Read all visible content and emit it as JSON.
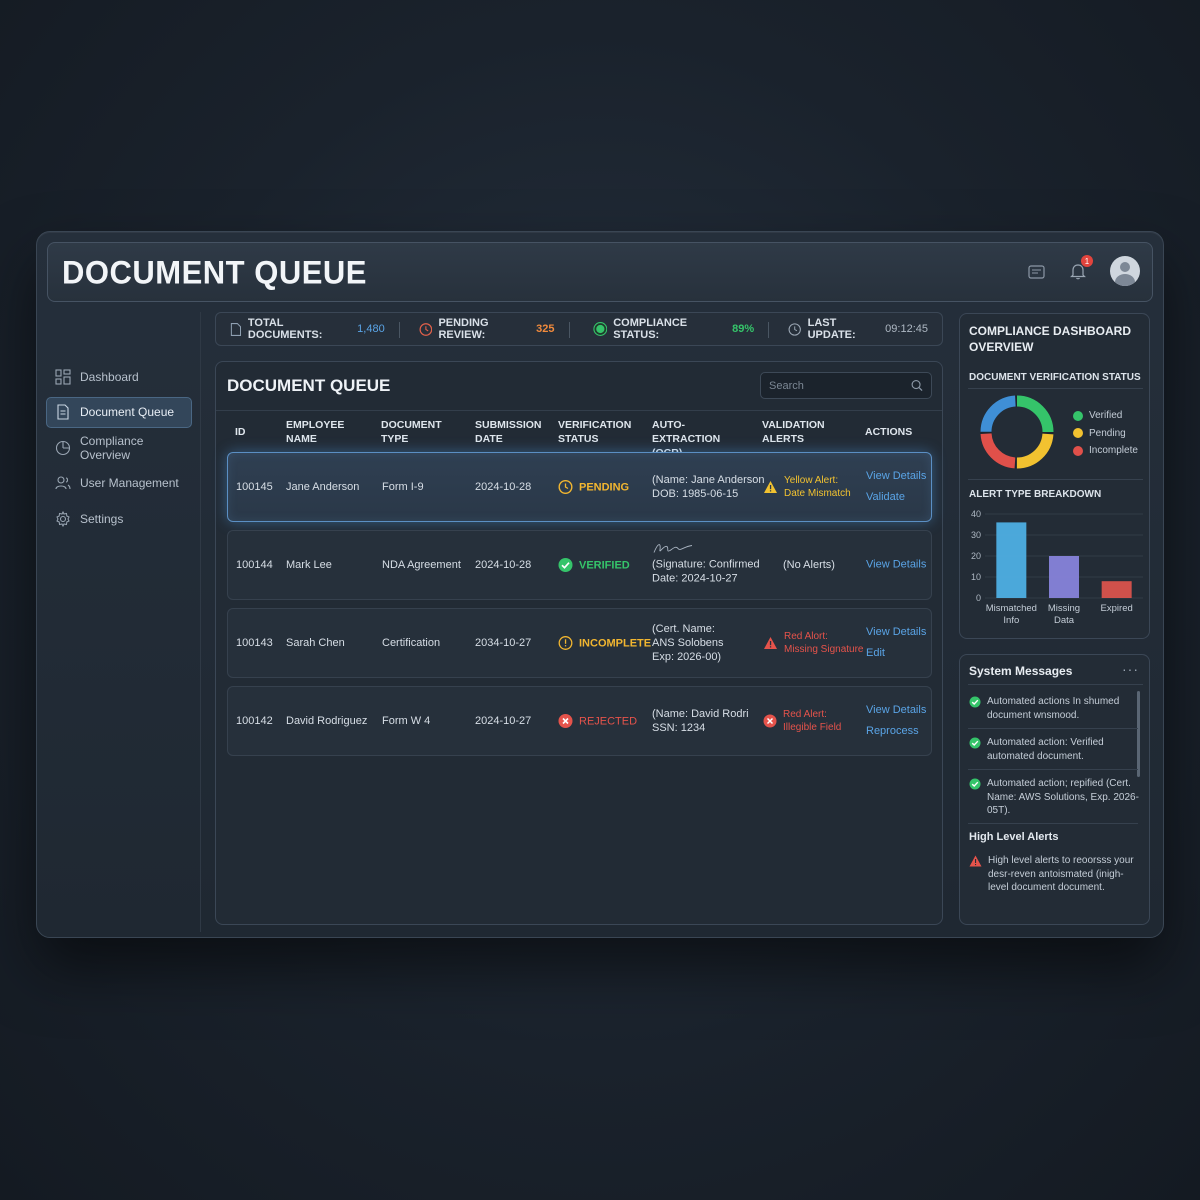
{
  "header": {
    "title": "DOCUMENT QUEUE",
    "notification_count": "1"
  },
  "sidebar": {
    "items": [
      {
        "label": "Dashboard",
        "icon": "grid-icon"
      },
      {
        "label": "Document Queue",
        "icon": "document-icon",
        "active": true
      },
      {
        "label": "Compliance Overview",
        "icon": "pie-chart-icon"
      },
      {
        "label": "User Management",
        "icon": "users-icon"
      },
      {
        "label": "Settings",
        "icon": "gear-icon"
      }
    ]
  },
  "stats": {
    "total_label": "TOTAL DOCUMENTS:",
    "total_value": "1,480",
    "pending_label": "PENDING REVIEW:",
    "pending_value": "325",
    "compliance_label": "COMPLIANCE STATUS:",
    "compliance_value": "89%",
    "update_label": "LAST UPDATE:",
    "update_value": "09:12:45"
  },
  "queue": {
    "title": "DOCUMENT QUEUE",
    "search_placeholder": "Search",
    "columns": [
      "ID",
      "EMPLOYEE NAME",
      "DOCUMENT TYPE",
      "SUBMISSION DATE",
      "VERIFICATION STATUS",
      "AUTO-EXTRACTION (OCR)",
      "VALIDATION ALERTS",
      "ACTIONS"
    ],
    "rows": [
      {
        "id": "100145",
        "name": "Jane Anderson",
        "type": "Form I-9",
        "date": "2024-10-28",
        "status": "PENDING",
        "ocr_1": "(Name: Jane Anderson",
        "ocr_2": "DOB: 1985-06-15",
        "alert_1": "Yellow Alert:",
        "alert_2": "Date Mismatch",
        "action_1": "View Details",
        "action_2": "Validate"
      },
      {
        "id": "100144",
        "name": "Mark Lee",
        "type": "NDA Agreement",
        "date": "2024-10-28",
        "status": "VERIFIED",
        "ocr_1": "(Signature: Confirmed",
        "ocr_2": "Date: 2024-10-27",
        "alert_1": "(No Alerts)",
        "action_1": "View Details"
      },
      {
        "id": "100143",
        "name": "Sarah Chen",
        "type": "Certification",
        "date": "2034-10-27",
        "status": "INCOMPLETE",
        "ocr_1": "(Cert. Name:",
        "ocr_2": "ANS Solobens",
        "ocr_3": "Exp: 2026-00)",
        "alert_1": "Red Alort:",
        "alert_2": "Missing Signature",
        "action_1": "View Details",
        "action_2": "Edit"
      },
      {
        "id": "100142",
        "name": "David Rodriguez",
        "type": "Form W 4",
        "date": "2024-10-27",
        "status": "REJECTED",
        "ocr_1": "(Name: David Rodri",
        "ocr_2": "SSN: 1234",
        "alert_1": "Red Alert:",
        "alert_2": "Illegible Field",
        "action_1": "View Details",
        "action_2": "Reprocess"
      }
    ]
  },
  "compliance": {
    "title": "COMPLIANCE DASHBOARD OVERVIEW",
    "verification_title": "DOCUMENT VERIFICATION STATUS",
    "legend": [
      {
        "label": "Verified",
        "color": "#35c46a"
      },
      {
        "label": "Pending",
        "color": "#f2c230"
      },
      {
        "label": "Incomplete",
        "color": "#e0504a"
      }
    ],
    "alert_title": "ALERT TYPE BREAKDOWN"
  },
  "chart_data": {
    "type": "bar",
    "title": "ALERT TYPE BREAKDOWN",
    "categories": [
      "Mismatched Info",
      "Missing Data",
      "Expired"
    ],
    "values": [
      36,
      20,
      8
    ],
    "y_ticks": [
      "0",
      "10",
      "20",
      "30",
      "40"
    ],
    "ylim": [
      0,
      40
    ],
    "colors": [
      "#4fb3e8",
      "#8a86e0",
      "#e0554d"
    ],
    "grid": true
  },
  "donut_data": {
    "type": "pie",
    "segments": [
      {
        "label": "Verified",
        "value": 0.26,
        "color": "#35c46a"
      },
      {
        "label": "Pending",
        "value": 0.25,
        "color": "#f2c230"
      },
      {
        "label": "Incomplete",
        "value": 0.24,
        "color": "#e0504a"
      },
      {
        "label": "Other",
        "value": 0.25,
        "color": "#3f8fd6"
      }
    ]
  },
  "messages": {
    "title": "System Messages",
    "items": [
      {
        "text": "Automated actions In shumed document wnsmood."
      },
      {
        "text": "Automated action: Verified automated document."
      },
      {
        "text": "Automated action; repified (Cert. Name: AWS Solutions, Exp. 2026-05T)."
      }
    ],
    "high_title": "High Level Alerts",
    "high_text": "High level alerts to reoorsss your desr-reven antoismated (inigh-level document document."
  }
}
